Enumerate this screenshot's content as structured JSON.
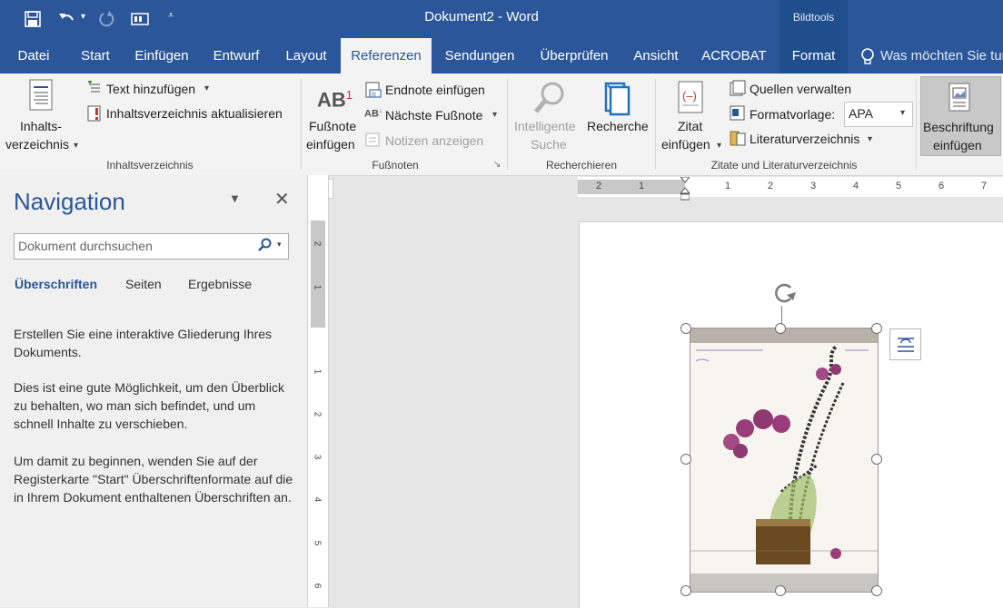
{
  "window": {
    "doc_title": "Dokument2 - Word",
    "contextual_tab_group": "Bildtools"
  },
  "tabs": [
    {
      "label": "Datei"
    },
    {
      "label": "Start"
    },
    {
      "label": "Einfügen"
    },
    {
      "label": "Entwurf"
    },
    {
      "label": "Layout"
    },
    {
      "label": "Referenzen"
    },
    {
      "label": "Sendungen"
    },
    {
      "label": "Überprüfen"
    },
    {
      "label": "Ansicht"
    },
    {
      "label": "ACROBAT"
    },
    {
      "label": "Format"
    }
  ],
  "tell_me": "Was möchten Sie tun",
  "ribbon": {
    "toc": {
      "big_button_line1": "Inhalts-",
      "big_button_line2": "verzeichnis",
      "add_text": "Text hinzufügen",
      "update_toc": "Inhaltsverzeichnis aktualisieren",
      "group_label": "Inhaltsverzeichnis"
    },
    "footnotes": {
      "icon_text": "AB",
      "icon_sup": "1",
      "big_button_line1": "Fußnote",
      "big_button_line2": "einfügen",
      "insert_endnote": "Endnote einfügen",
      "next_footnote": "Nächste Fußnote",
      "show_notes": "Notizen anzeigen",
      "group_label": "Fußnoten"
    },
    "research": {
      "smart_lookup_line1": "Intelligente",
      "smart_lookup_line2": "Suche",
      "researcher": "Recherche",
      "group_label": "Recherchieren"
    },
    "citations": {
      "insert_citation_line1": "Zitat",
      "insert_citation_line2": "einfügen",
      "manage_sources": "Quellen verwalten",
      "style_label": "Formatvorlage:",
      "style_value": "APA",
      "bibliography": "Literaturverzeichnis",
      "group_label": "Zitate und Literaturverzeichnis"
    },
    "captions": {
      "insert_caption_line1": "Beschriftung",
      "insert_caption_line2": "einfügen"
    }
  },
  "navigation": {
    "title": "Navigation",
    "search_placeholder": "Dokument durchsuchen",
    "tabs": [
      {
        "label": "Überschriften"
      },
      {
        "label": "Seiten"
      },
      {
        "label": "Ergebnisse"
      }
    ],
    "para1": "Erstellen Sie eine interaktive Gliederung Ihres Dokuments.",
    "para2": "Dies ist eine gute Möglichkeit, um den Überblick zu behalten, wo man sich befindet, und um schnell Inhalte zu verschieben.",
    "para3": "Um damit zu beginnen, wenden Sie auf der Registerkarte \"Start\" Überschriftenformate auf die in Ihrem Dokument enthaltenen Überschriften an."
  },
  "ruler": {
    "h_labels": [
      "2",
      "1",
      "1",
      "2",
      "3",
      "4",
      "5",
      "6",
      "7"
    ],
    "v_labels": [
      "2",
      "1",
      "1",
      "2",
      "3",
      "4",
      "5",
      "6"
    ],
    "tab_selector": "L"
  },
  "colors": {
    "word_blue": "#2b579a",
    "dark_blue": "#1f4e8c",
    "ribbon_bg": "#f3f3f3",
    "nav_title": "#2b579a"
  }
}
